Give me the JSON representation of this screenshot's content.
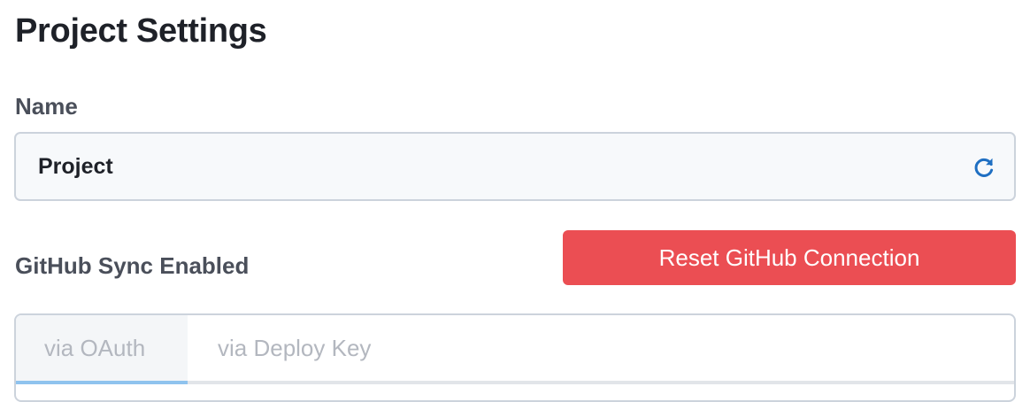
{
  "page": {
    "title": "Project Settings"
  },
  "name_field": {
    "label": "Name",
    "value": "Project",
    "refresh_icon": "refresh-icon"
  },
  "github_sync": {
    "label": "GitHub Sync Enabled",
    "reset_button_label": "Reset GitHub Connection",
    "tabs": [
      {
        "label": "via OAuth",
        "active": true
      },
      {
        "label": "via Deploy Key",
        "active": false
      }
    ]
  },
  "colors": {
    "danger": "#eb4e53",
    "active_tab_underline": "#8fc3ee",
    "icon_accent": "#1f6fc2"
  }
}
